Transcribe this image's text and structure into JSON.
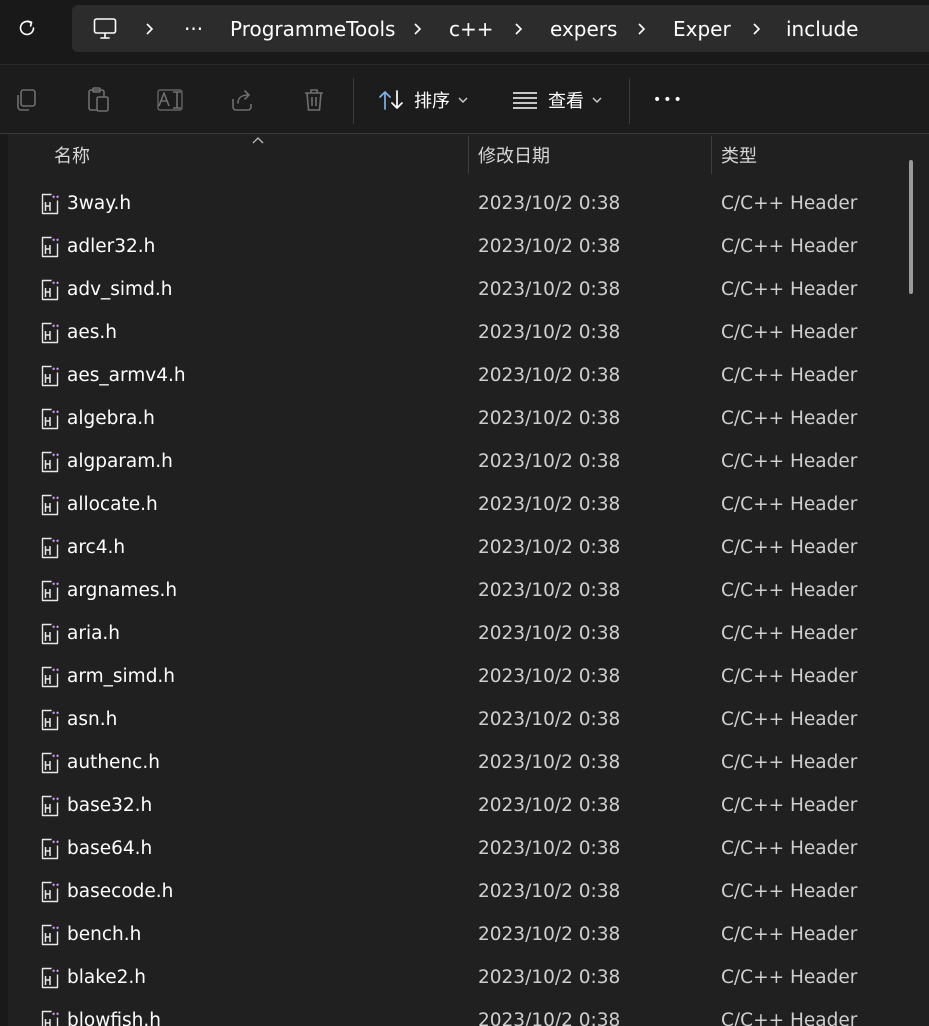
{
  "address": {
    "more_glyph": "···",
    "segments": [
      "ProgrammeTools",
      "c++",
      "expers",
      "Exper",
      "include"
    ]
  },
  "toolbar": {
    "sort_label": "排序",
    "view_label": "查看",
    "more_glyph": "•••"
  },
  "columns": {
    "name": "名称",
    "date": "修改日期",
    "type": "类型"
  },
  "files": [
    {
      "name": "3way.h",
      "date": "2023/10/2 0:38",
      "type": "C/C++ Header"
    },
    {
      "name": "adler32.h",
      "date": "2023/10/2 0:38",
      "type": "C/C++ Header"
    },
    {
      "name": "adv_simd.h",
      "date": "2023/10/2 0:38",
      "type": "C/C++ Header"
    },
    {
      "name": "aes.h",
      "date": "2023/10/2 0:38",
      "type": "C/C++ Header"
    },
    {
      "name": "aes_armv4.h",
      "date": "2023/10/2 0:38",
      "type": "C/C++ Header"
    },
    {
      "name": "algebra.h",
      "date": "2023/10/2 0:38",
      "type": "C/C++ Header"
    },
    {
      "name": "algparam.h",
      "date": "2023/10/2 0:38",
      "type": "C/C++ Header"
    },
    {
      "name": "allocate.h",
      "date": "2023/10/2 0:38",
      "type": "C/C++ Header"
    },
    {
      "name": "arc4.h",
      "date": "2023/10/2 0:38",
      "type": "C/C++ Header"
    },
    {
      "name": "argnames.h",
      "date": "2023/10/2 0:38",
      "type": "C/C++ Header"
    },
    {
      "name": "aria.h",
      "date": "2023/10/2 0:38",
      "type": "C/C++ Header"
    },
    {
      "name": "arm_simd.h",
      "date": "2023/10/2 0:38",
      "type": "C/C++ Header"
    },
    {
      "name": "asn.h",
      "date": "2023/10/2 0:38",
      "type": "C/C++ Header"
    },
    {
      "name": "authenc.h",
      "date": "2023/10/2 0:38",
      "type": "C/C++ Header"
    },
    {
      "name": "base32.h",
      "date": "2023/10/2 0:38",
      "type": "C/C++ Header"
    },
    {
      "name": "base64.h",
      "date": "2023/10/2 0:38",
      "type": "C/C++ Header"
    },
    {
      "name": "basecode.h",
      "date": "2023/10/2 0:38",
      "type": "C/C++ Header"
    },
    {
      "name": "bench.h",
      "date": "2023/10/2 0:38",
      "type": "C/C++ Header"
    },
    {
      "name": "blake2.h",
      "date": "2023/10/2 0:38",
      "type": "C/C++ Header"
    },
    {
      "name": "blowfish.h",
      "date": "2023/10/2 0:38",
      "type": "C/C++ Header"
    }
  ]
}
